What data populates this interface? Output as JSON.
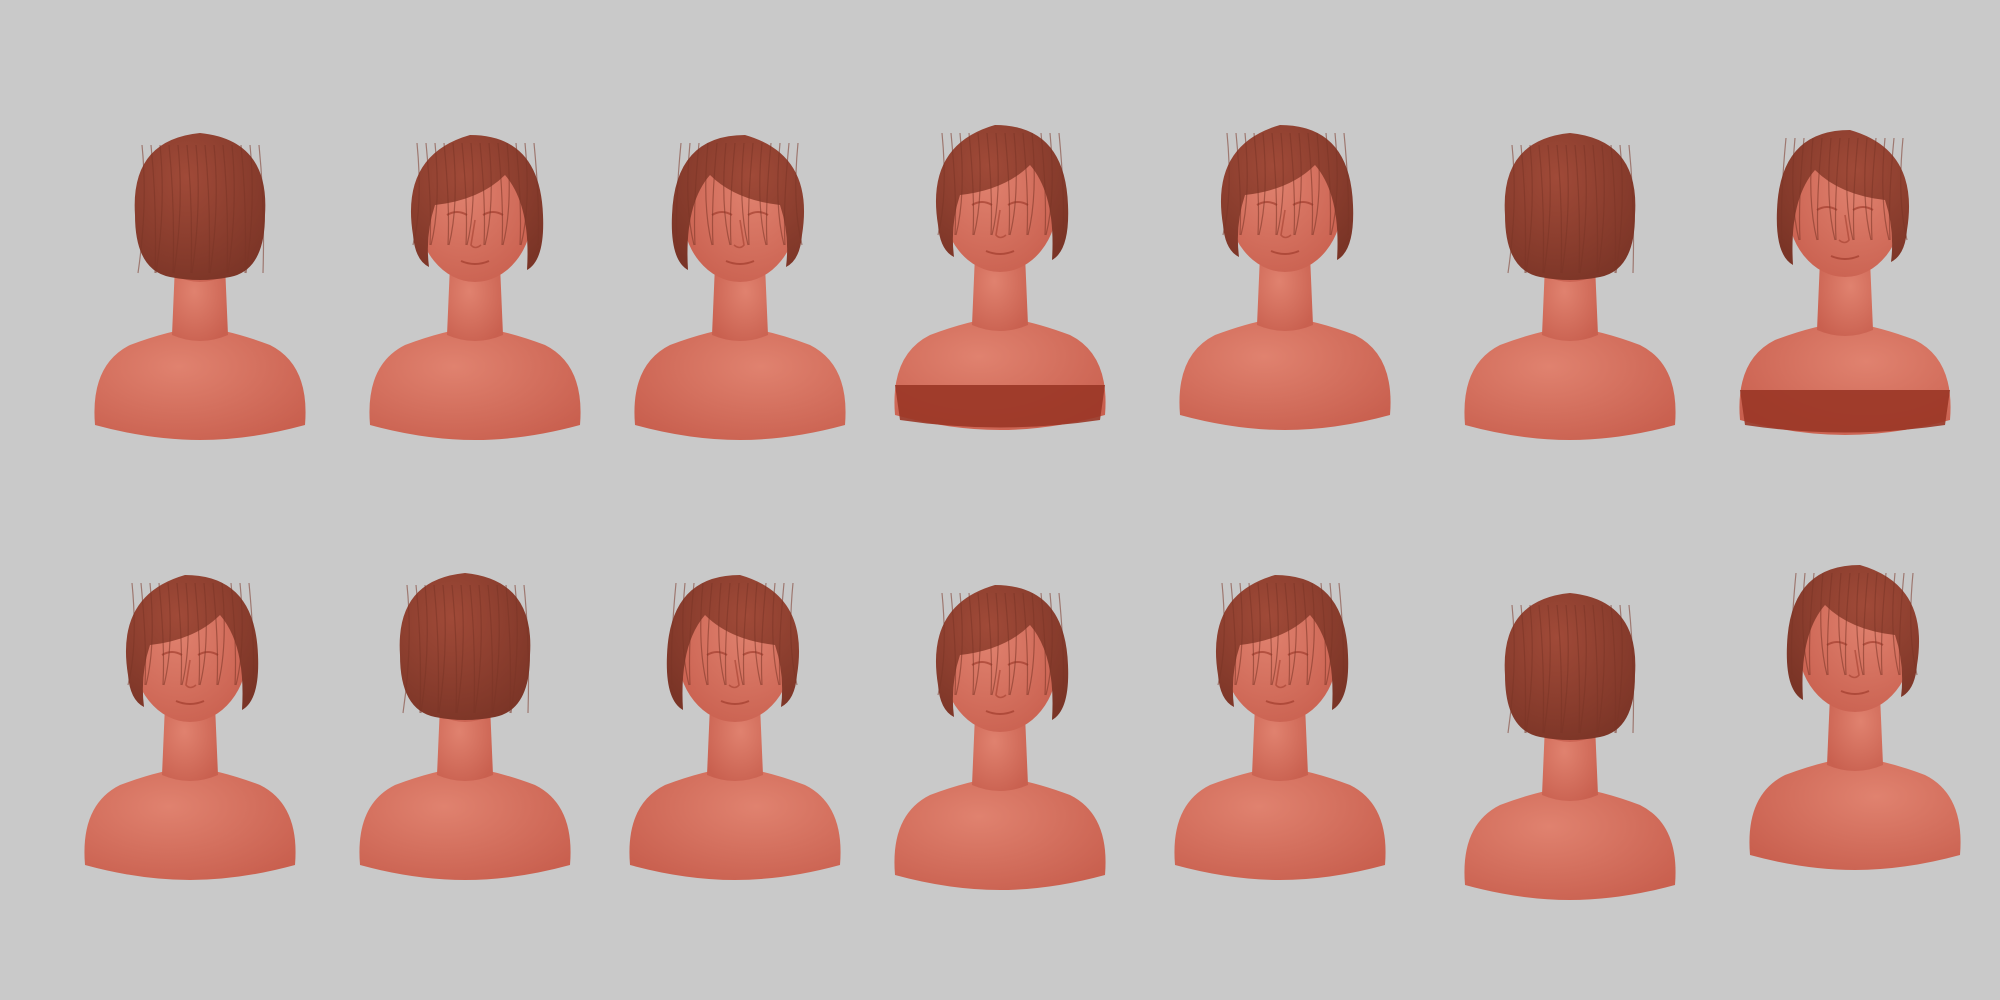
{
  "colors": {
    "background": "#c9c9c9",
    "skin": "#c9604f",
    "skin_light": "#e0826f",
    "hair": "#a04a38",
    "hair_dark": "#7a3426",
    "base_dark": "#9a3626"
  },
  "busts": [
    {
      "view": "back"
    },
    {
      "view": "three-quarter-right"
    },
    {
      "view": "profile-left"
    },
    {
      "view": "low-front"
    },
    {
      "view": "front"
    },
    {
      "view": "three-quarter-right-back"
    },
    {
      "view": "tilted-left"
    },
    {
      "view": "three-quarter-right"
    },
    {
      "view": "top-back"
    },
    {
      "view": "three-quarter-left"
    },
    {
      "view": "high-three-quarter"
    },
    {
      "view": "front"
    },
    {
      "view": "top-down"
    },
    {
      "view": "three-quarter-left"
    }
  ]
}
